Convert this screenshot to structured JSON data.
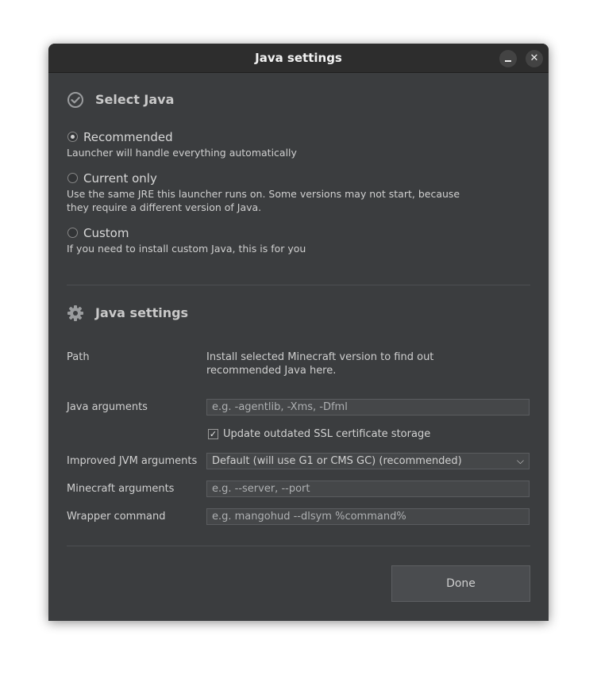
{
  "window": {
    "title": "Java settings",
    "minimize_icon": "minimize-icon",
    "close_icon": "close-icon",
    "close_glyph": "✕"
  },
  "select_java": {
    "heading": "Select Java",
    "icon": "check-circle-icon",
    "options": [
      {
        "label": "Recommended",
        "description": "Launcher will handle everything automatically",
        "selected": true
      },
      {
        "label": "Current only",
        "description_lines": [
          "Use the same JRE this launcher runs on. Some versions may not start, because",
          "they require a different version of Java."
        ],
        "selected": false
      },
      {
        "label": "Custom",
        "description": "If you need to install custom Java, this is for you",
        "selected": false
      }
    ]
  },
  "java_settings": {
    "heading": "Java settings",
    "icon": "gear-icon",
    "path": {
      "label": "Path",
      "value_lines": [
        "Install selected Minecraft version to find out",
        "recommended Java here."
      ]
    },
    "java_arguments": {
      "label": "Java arguments",
      "placeholder": "e.g. -agentlib, -Xms, -Dfml"
    },
    "ssl_checkbox": {
      "label": "Update outdated SSL certificate storage",
      "checked": true,
      "glyph": "✓"
    },
    "jvm_arguments": {
      "label": "Improved JVM arguments",
      "selected": "Default (will use G1 or CMS GC) (recommended)",
      "chevron": "⌵"
    },
    "minecraft_arguments": {
      "label": "Minecraft arguments",
      "placeholder": "e.g. --server, --port"
    },
    "wrapper_command": {
      "label": "Wrapper command",
      "placeholder": "e.g. mangohud --dlsym %command%"
    }
  },
  "footer": {
    "done_label": "Done"
  }
}
